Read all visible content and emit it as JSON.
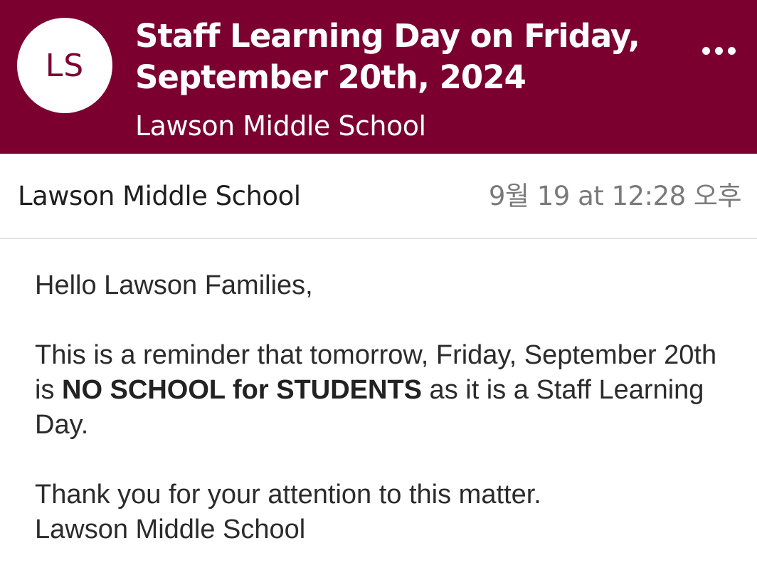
{
  "header": {
    "avatar_initials": "LS",
    "title": "Staff Learning Day on Friday, September 20th, 2024",
    "subtitle": "Lawson Middle School",
    "more_icon": "more-horizontal-icon",
    "background_color": "#7b0030"
  },
  "message": {
    "sender": "Lawson Middle School",
    "timestamp": "9월 19 at 12:28 오후",
    "greeting": "Hello Lawson Families,",
    "reminder_before": "This is a reminder that tomorrow, Friday, September 20th is ",
    "reminder_bold": "NO SCHOOL for STUDENTS",
    "reminder_after": " as it is a Staff Learning Day.",
    "closing_line": "Thank you for your attention to this matter.",
    "signature": "Lawson Middle School"
  }
}
